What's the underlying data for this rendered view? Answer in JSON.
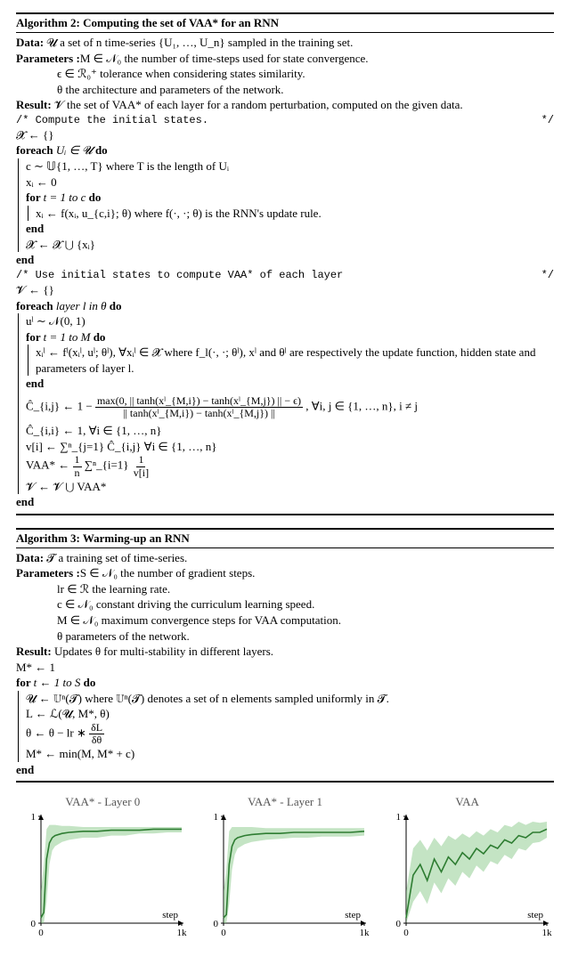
{
  "algo2": {
    "title": "Algorithm 2: Computing the set of VAA* for an RNN",
    "data": "𝓤 a set of n time-series {U₁, …, U_n} sampled in the training set.",
    "param1": "M ∈ 𝒩₀ the number of time-steps used for state convergence.",
    "param2": "ϵ ∈ ℛ₀⁺ tolerance when considering states similarity.",
    "param3": "θ the architecture and parameters of the network.",
    "result": "𝓥 the set of VAA* of each layer for a random perturbation, computed on the given data.",
    "comment1": "/* Compute the initial states.",
    "comment1_end": "*/",
    "line1": "𝓧 ← {}",
    "foreach1": "Uᵢ ∈ 𝓤",
    "f1_l1": "c ∼ 𝕌{1, …, T} where T is the length of Uᵢ",
    "f1_l2": "xᵢ ← 0",
    "f1_for": "t = 1 to c",
    "f1_l3": "xᵢ ← f(xᵢ, u_{c,i}; θ) where f(·, ·; θ) is the RNN's update rule.",
    "f1_end1": "end",
    "f1_l4": "𝓧 ← 𝓧 ⋃ {xᵢ}",
    "f1_end2": "end",
    "comment2": "/* Use initial states to compute VAA* of each layer",
    "comment2_end": "*/",
    "line2": "𝓥 ← {}",
    "foreach2": "layer l in θ",
    "f2_l1": "uˡ ∼ 𝒩(0, 1)",
    "f2_for": "t = 1 to M",
    "f2_l2": "xᵢˡ ← fˡ(xᵢˡ, uˡ; θˡ), ∀xᵢˡ ∈ 𝓧 where f_l(·, ·; θˡ), xˡ and θˡ are respectively the update function, hidden state and parameters of layer l.",
    "f2_end1": "end",
    "f2_hatC_a": "Ĉ_{i,j} ← 1 −",
    "f2_hatC_num": "max(0, || tanh(xˡ_{M,i}) − tanh(xˡ_{M,j}) || − ϵ)",
    "f2_hatC_den": "|| tanh(xˡ_{M,i}) − tanh(xˡ_{M,j}) ||",
    "f2_hatC_b": ",  ∀i, j ∈ {1, …, n}, i ≠ j",
    "f2_l3": "Ĉ_{i,i} ← 1,  ∀i ∈ {1, …, n}",
    "f2_l4": "v[i] ← ∑ⁿ_{j=1} Ĉ_{i,j}  ∀i ∈ {1, …, n}",
    "f2_l5a": "VAA* ←",
    "f2_l5_num1": "1",
    "f2_l5_den1": "n",
    "f2_l5_mid": " ∑ⁿ_{i=1} ",
    "f2_l5_num2": "1",
    "f2_l5_den2": "v[i]",
    "f2_l6": "𝓥 ← 𝓥 ⋃ VAA*",
    "f2_end2": "end"
  },
  "algo3": {
    "title": "Algorithm 3: Warming-up an RNN",
    "data": "𝓣 a training set of time-series.",
    "param1": "S ∈ 𝒩₀ the number of gradient steps.",
    "param2": "lr ∈ ℛ the learning rate.",
    "param3": "c ∈ 𝒩₀ constant driving the curriculum learning speed.",
    "param4": "M ∈ 𝒩₀ maximum convergence steps for VAA computation.",
    "param5": "θ parameters of the network.",
    "result": "Updates θ for multi-stability in different layers.",
    "l1": "M* ← 1",
    "for": "t ← 1 to S",
    "f_l1": "𝓤 ← 𝕌ⁿ(𝓣) where 𝕌ⁿ(𝓣) denotes a set of n elements sampled uniformly in 𝓣.",
    "f_l2": "L ← ℒ(𝓤, M*, θ)",
    "f_l3a": "θ ← θ − lr ∗ ",
    "f_l3_num": "δL",
    "f_l3_den": "δθ",
    "f_l4": "M* ← min(M, M* + c)",
    "f_end": "end"
  },
  "labels": {
    "data": "Data: ",
    "params": "Parameters :",
    "result": "Result: ",
    "foreach": "foreach ",
    "do": " do",
    "for": "for ",
    "end": "end"
  },
  "chart_data": [
    {
      "type": "line",
      "title": "VAA* - Layer 0",
      "xlabel": "step",
      "ylabel": "",
      "xlim": [
        0,
        1000
      ],
      "ylim": [
        0,
        1
      ],
      "xticks": [
        0,
        1000
      ],
      "xticklabels": [
        "0",
        "1k"
      ],
      "yticks": [
        0,
        1
      ],
      "series": [
        {
          "name": "mean",
          "x": [
            0,
            20,
            40,
            60,
            80,
            100,
            150,
            200,
            300,
            400,
            500,
            600,
            700,
            800,
            900,
            1000
          ],
          "y": [
            0.05,
            0.1,
            0.6,
            0.75,
            0.8,
            0.82,
            0.84,
            0.85,
            0.86,
            0.86,
            0.87,
            0.87,
            0.87,
            0.88,
            0.88,
            0.88
          ]
        },
        {
          "name": "band_upper",
          "x": [
            0,
            20,
            40,
            60,
            80,
            100,
            150,
            200,
            300,
            400,
            500,
            600,
            700,
            800,
            900,
            1000
          ],
          "y": [
            0.3,
            0.55,
            0.88,
            0.92,
            0.92,
            0.92,
            0.91,
            0.91,
            0.9,
            0.9,
            0.9,
            0.9,
            0.9,
            0.9,
            0.9,
            0.9
          ]
        },
        {
          "name": "band_lower",
          "x": [
            0,
            20,
            40,
            60,
            80,
            100,
            150,
            200,
            300,
            400,
            500,
            600,
            700,
            800,
            900,
            1000
          ],
          "y": [
            0.0,
            0.0,
            0.2,
            0.55,
            0.68,
            0.72,
            0.76,
            0.78,
            0.8,
            0.8,
            0.82,
            0.82,
            0.84,
            0.84,
            0.85,
            0.85
          ]
        }
      ]
    },
    {
      "type": "line",
      "title": "VAA* - Layer 1",
      "xlabel": "step",
      "ylabel": "",
      "xlim": [
        0,
        1000
      ],
      "ylim": [
        0,
        1
      ],
      "xticks": [
        0,
        1000
      ],
      "xticklabels": [
        "0",
        "1k"
      ],
      "yticks": [
        0,
        1
      ],
      "series": [
        {
          "name": "mean",
          "x": [
            0,
            20,
            40,
            60,
            80,
            100,
            150,
            200,
            300,
            400,
            500,
            600,
            700,
            800,
            900,
            1000
          ],
          "y": [
            0.05,
            0.08,
            0.55,
            0.72,
            0.78,
            0.8,
            0.82,
            0.83,
            0.84,
            0.84,
            0.85,
            0.85,
            0.85,
            0.85,
            0.85,
            0.86
          ]
        },
        {
          "name": "band_upper",
          "x": [
            0,
            20,
            40,
            60,
            80,
            100,
            150,
            200,
            300,
            400,
            500,
            600,
            700,
            800,
            900,
            1000
          ],
          "y": [
            0.3,
            0.5,
            0.86,
            0.9,
            0.9,
            0.9,
            0.9,
            0.9,
            0.89,
            0.89,
            0.89,
            0.89,
            0.89,
            0.89,
            0.89,
            0.89
          ]
        },
        {
          "name": "band_lower",
          "x": [
            0,
            20,
            40,
            60,
            80,
            100,
            150,
            200,
            300,
            400,
            500,
            600,
            700,
            800,
            900,
            1000
          ],
          "y": [
            0.0,
            0.0,
            0.18,
            0.5,
            0.64,
            0.7,
            0.74,
            0.76,
            0.78,
            0.79,
            0.8,
            0.8,
            0.81,
            0.81,
            0.81,
            0.82
          ]
        }
      ]
    },
    {
      "type": "line",
      "title": "VAA",
      "xlabel": "step",
      "ylabel": "",
      "xlim": [
        0,
        1000
      ],
      "ylim": [
        0,
        1
      ],
      "xticks": [
        0,
        1000
      ],
      "xticklabels": [
        "0",
        "1k"
      ],
      "yticks": [
        0,
        1
      ],
      "series": [
        {
          "name": "mean",
          "x": [
            0,
            50,
            100,
            150,
            200,
            250,
            300,
            350,
            400,
            450,
            500,
            550,
            600,
            650,
            700,
            750,
            800,
            850,
            900,
            950,
            1000
          ],
          "y": [
            0.05,
            0.45,
            0.55,
            0.4,
            0.6,
            0.48,
            0.62,
            0.55,
            0.66,
            0.6,
            0.7,
            0.65,
            0.73,
            0.7,
            0.78,
            0.75,
            0.82,
            0.8,
            0.85,
            0.85,
            0.88
          ]
        },
        {
          "name": "band_upper",
          "x": [
            0,
            50,
            100,
            150,
            200,
            250,
            300,
            350,
            400,
            450,
            500,
            550,
            600,
            650,
            700,
            750,
            800,
            850,
            900,
            950,
            1000
          ],
          "y": [
            0.3,
            0.7,
            0.78,
            0.68,
            0.8,
            0.72,
            0.82,
            0.78,
            0.84,
            0.8,
            0.86,
            0.82,
            0.88,
            0.85,
            0.92,
            0.9,
            0.95,
            0.92,
            0.95,
            0.94,
            0.95
          ]
        },
        {
          "name": "band_lower",
          "x": [
            0,
            50,
            100,
            150,
            200,
            250,
            300,
            350,
            400,
            450,
            500,
            550,
            600,
            650,
            700,
            750,
            800,
            850,
            900,
            950,
            1000
          ],
          "y": [
            0.0,
            0.2,
            0.3,
            0.18,
            0.38,
            0.28,
            0.42,
            0.35,
            0.48,
            0.42,
            0.54,
            0.48,
            0.58,
            0.55,
            0.64,
            0.6,
            0.7,
            0.68,
            0.75,
            0.76,
            0.8
          ]
        }
      ]
    }
  ]
}
